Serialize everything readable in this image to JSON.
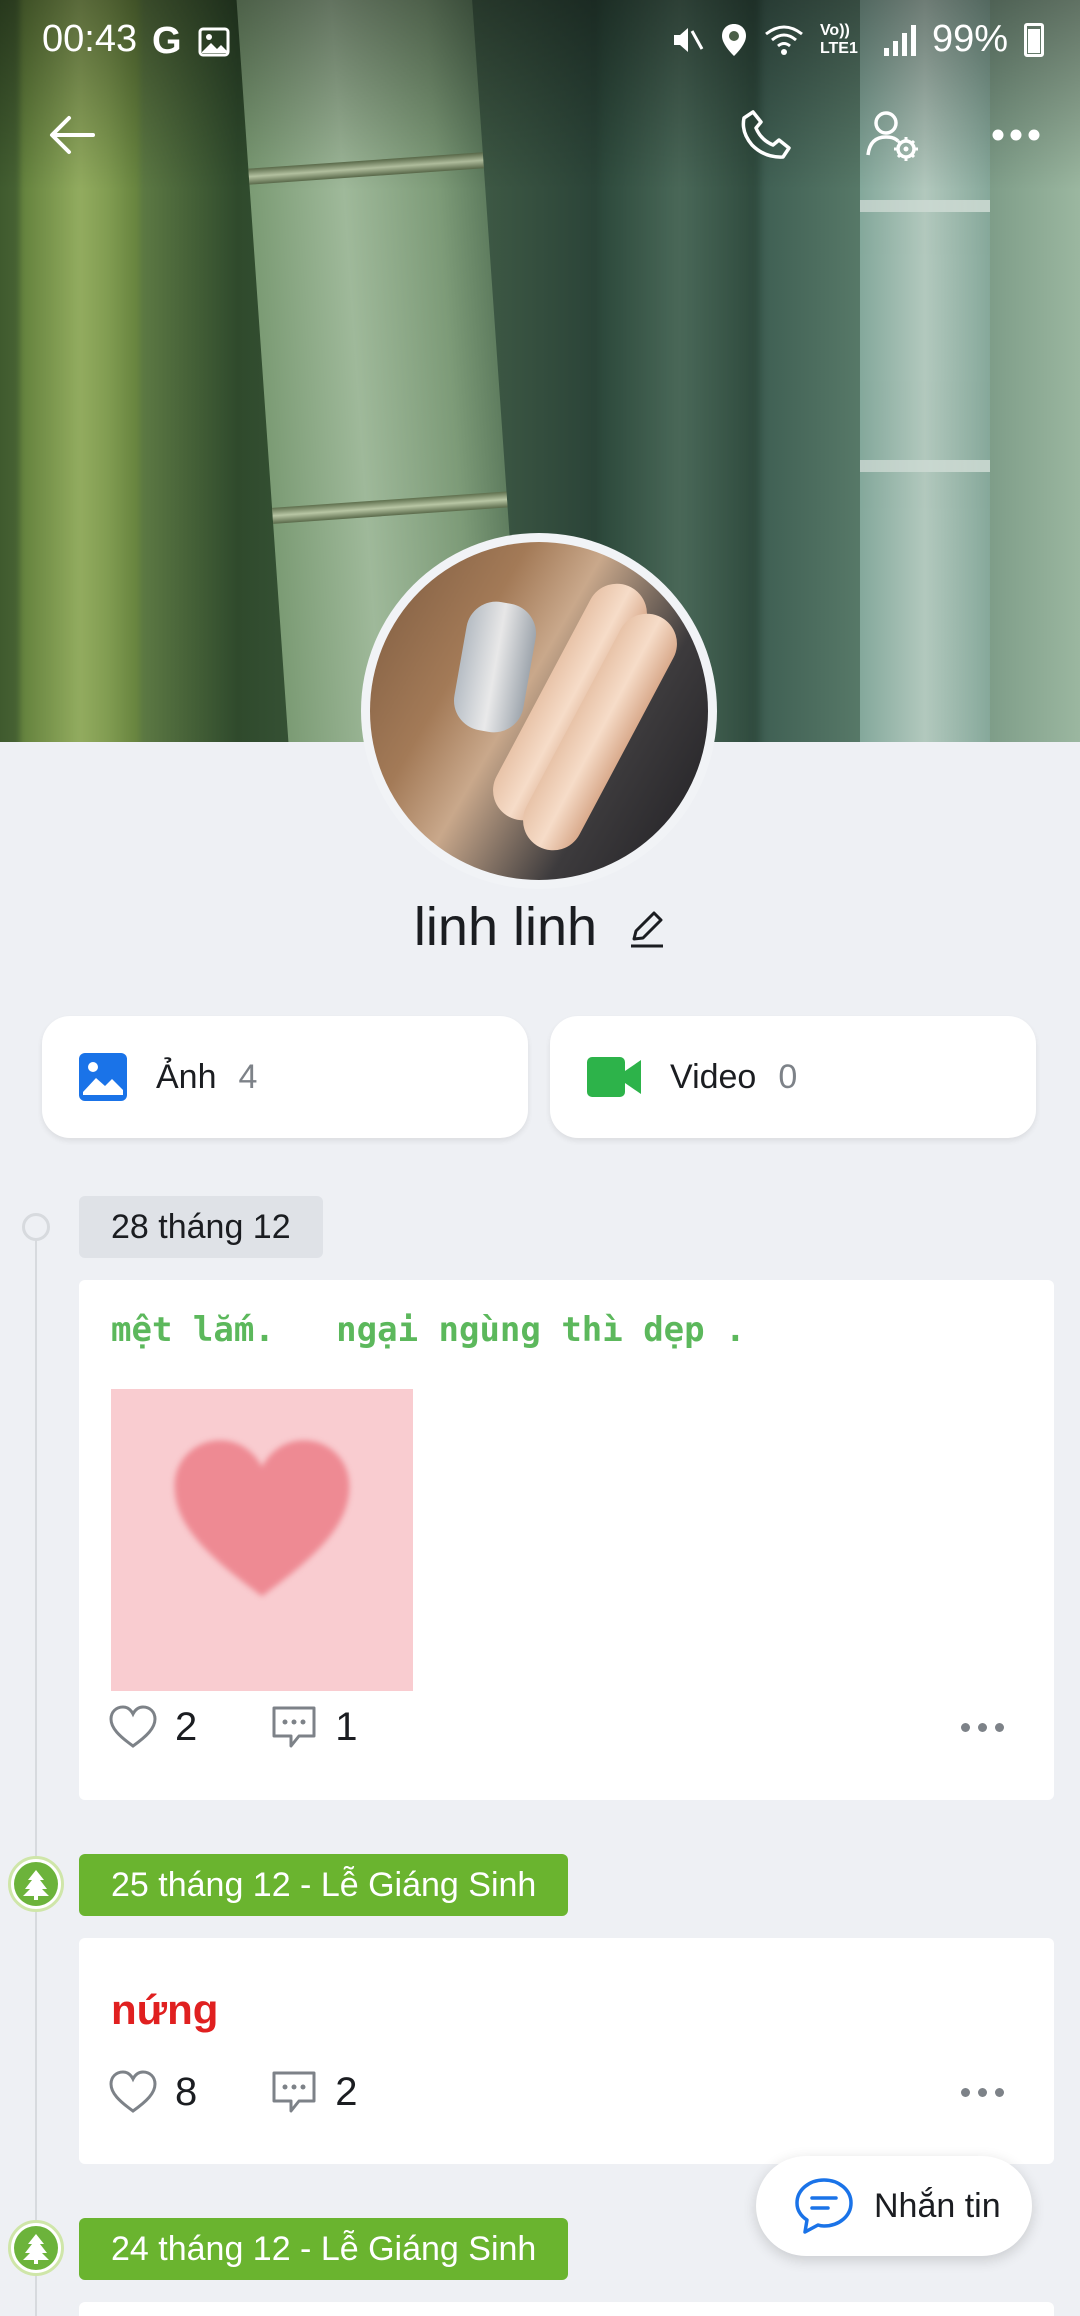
{
  "status_bar": {
    "time": "00:43",
    "battery": "99%",
    "network": "Vo)) LTE1"
  },
  "profile": {
    "name": "linh linh"
  },
  "media": {
    "photos_label": "Ảnh",
    "photos_count": "4",
    "videos_label": "Video",
    "videos_count": "0"
  },
  "timeline": [
    {
      "date": "28 tháng 12",
      "text": "mệt lắm.   ngại ngùng thì dẹp .",
      "likes": "2",
      "comments": "1"
    },
    {
      "date": "25 tháng 12 - Lễ Giáng Sinh",
      "text": "nứng",
      "likes": "8",
      "comments": "2"
    },
    {
      "date": "24 tháng 12 - Lễ Giáng Sinh"
    }
  ],
  "message_button": {
    "label": "Nhắn tin"
  },
  "colors": {
    "accent_green": "#6ab42f",
    "photo_icon_blue": "#1a73e8",
    "video_icon_green": "#2db34a",
    "post_text_green": "#5cb85c",
    "post_text_red": "#e02020",
    "message_blue": "#1a73e8"
  },
  "icons": [
    "back-arrow-icon",
    "phone-icon",
    "user-settings-icon",
    "more-icon",
    "edit-icon",
    "photo-icon",
    "video-icon",
    "heart-icon",
    "comment-icon",
    "christmas-tree-icon",
    "chat-bubble-icon"
  ]
}
